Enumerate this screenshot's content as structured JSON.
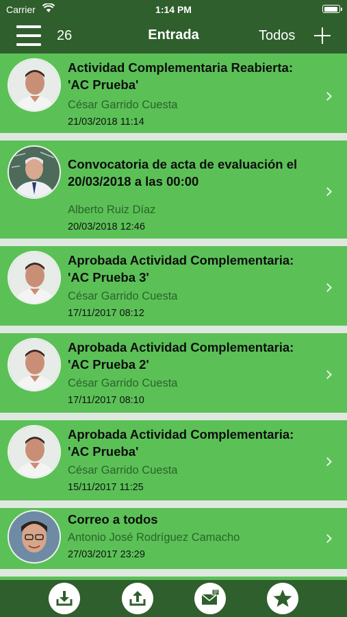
{
  "status": {
    "carrier": "Carrier",
    "time": "1:14 PM"
  },
  "nav": {
    "count": "26",
    "title": "Entrada",
    "filter": "Todos"
  },
  "messages": [
    {
      "subject": "Actividad Complementaria Reabierta: 'AC Prueba'",
      "sender": "César Garrido Cuesta",
      "date": "21/03/2018 11:14"
    },
    {
      "subject": "Convocatoria de acta de evaluación el 20/03/2018 a las 00:00",
      "sender": "Alberto Ruiz  Díaz",
      "date": "20/03/2018 12:46"
    },
    {
      "subject": "Aprobada Actividad Complementaria: 'AC Prueba 3'",
      "sender": "César Garrido Cuesta",
      "date": "17/11/2017 08:12"
    },
    {
      "subject": "Aprobada Actividad Complementaria: 'AC Prueba 2'",
      "sender": "César Garrido Cuesta",
      "date": "17/11/2017 08:10"
    },
    {
      "subject": "Aprobada Actividad Complementaria: 'AC Prueba'",
      "sender": "César Garrido Cuesta",
      "date": "15/11/2017 11:25"
    },
    {
      "subject": "Correo a todos",
      "sender": "Antonio José Rodríguez Camacho",
      "date": "27/03/2017 23:29"
    }
  ],
  "tabs": [
    {
      "icon": "download-icon"
    },
    {
      "icon": "upload-icon"
    },
    {
      "icon": "compose-mail-icon"
    },
    {
      "icon": "star-icon"
    }
  ],
  "colors": {
    "header": "#2f5f2c",
    "row": "#5bc157",
    "sender": "#2a6428",
    "separator": "#dfe8df"
  }
}
